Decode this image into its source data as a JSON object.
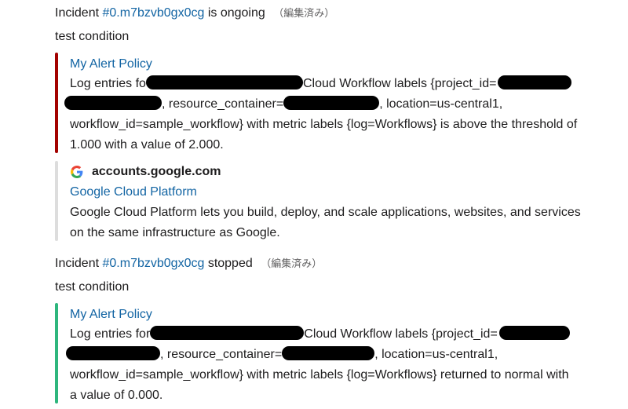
{
  "messages": [
    {
      "incident_prefix": "Incident",
      "incident_id": "#0.m7bzvb0gx0cg",
      "status": "is ongoing",
      "edited": "（編集済み）",
      "condition": "test condition",
      "attachment": {
        "bar_color": "#a30200",
        "title": "My Alert Policy",
        "text": {
          "p1": "Log entries fo",
          "p2": "Cloud Workflow labels {project_id=",
          "p3": ", resource_container=",
          "p4": ", location=us-central1,",
          "p5": "workflow_id=sample_workflow} with metric labels {log=Workflows} is above the threshold of",
          "p6": "1.000 with a value of 2.000."
        }
      }
    },
    {
      "incident_prefix": "Incident",
      "incident_id": "#0.m7bzvb0gx0cg",
      "status": "stopped",
      "edited": "（編集済み）",
      "condition": "test condition",
      "attachment": {
        "bar_color": "#2eb67d",
        "title": "My Alert Policy",
        "text": {
          "p1": "Log entries for",
          "p2": "Cloud Workflow labels {project_id=",
          "p3": ", resource_container=",
          "p4": ", location=us-central1,",
          "p5": "workflow_id=sample_workflow} with metric labels {log=Workflows} returned to normal with",
          "p6": "a value of 0.000."
        }
      }
    }
  ],
  "unfurl": {
    "bar_color": "#dddddd",
    "site": "accounts.google.com",
    "icon": "google-g-icon",
    "title": "Google Cloud Platform",
    "desc1": "Google Cloud Platform lets you build, deploy, and scale applications, websites, and services",
    "desc2": "on the same infrastructure as Google."
  }
}
